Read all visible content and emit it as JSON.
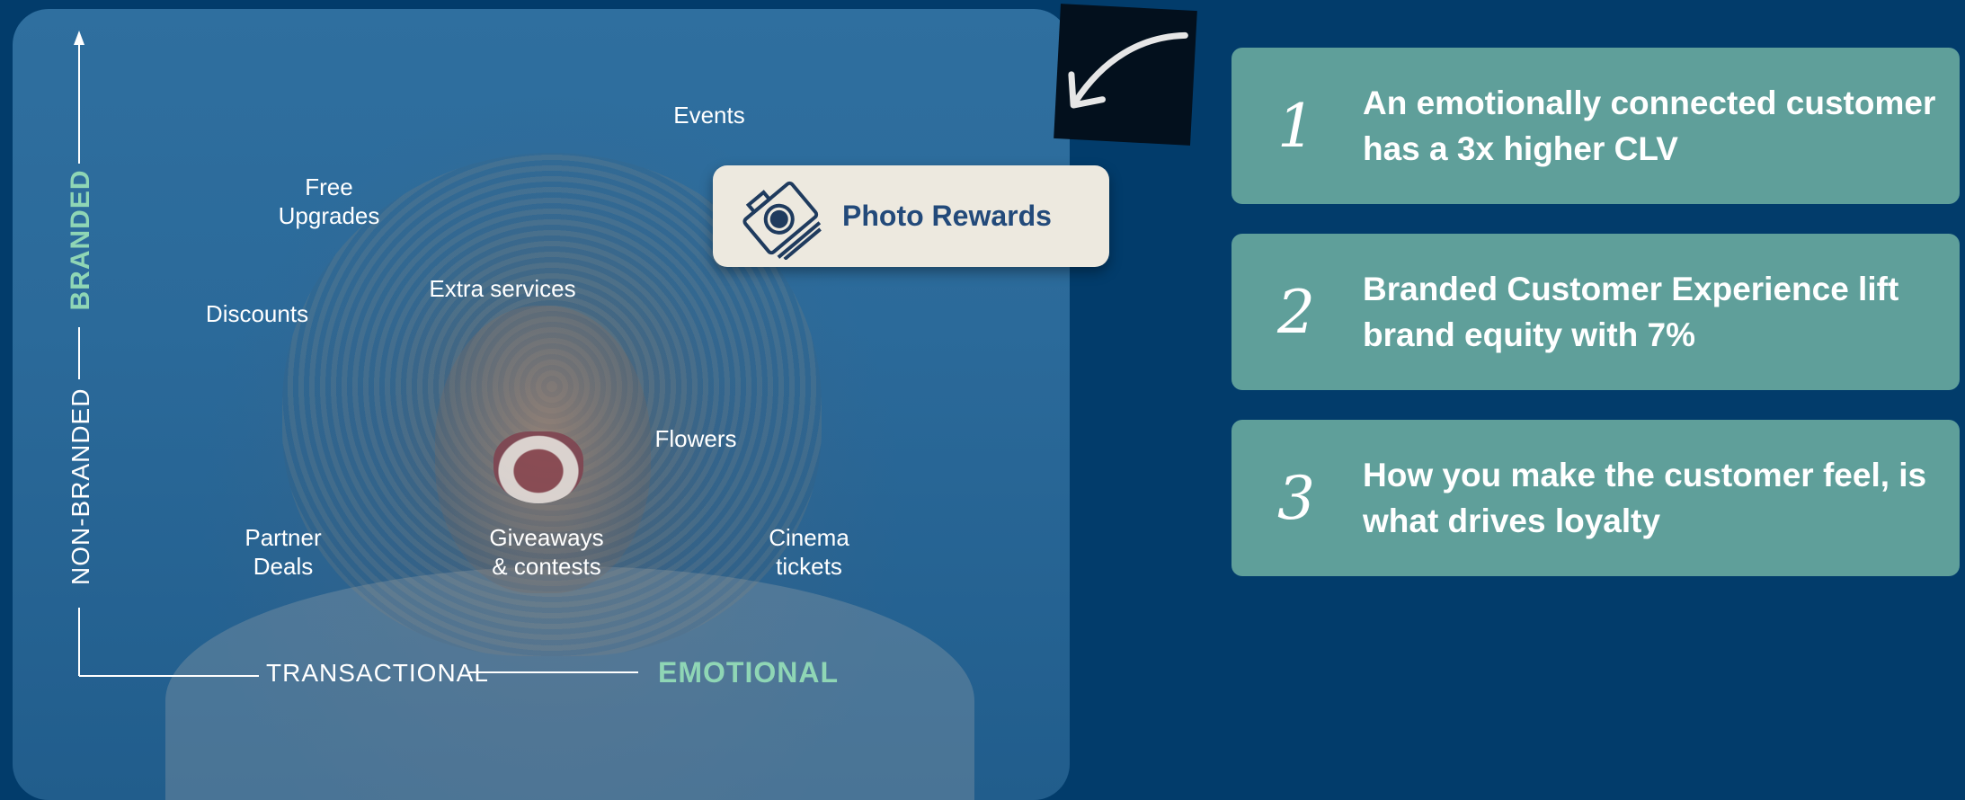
{
  "axes": {
    "y_top": "BRANDED",
    "y_bottom": "NON-BRANDED",
    "x_left": "TRANSACTIONAL",
    "x_right": "EMOTIONAL"
  },
  "items": [
    {
      "id": "events",
      "text": "Events"
    },
    {
      "id": "free-upgrades",
      "text": "Free\nUpgrades"
    },
    {
      "id": "extra-services",
      "text": "Extra services"
    },
    {
      "id": "discounts",
      "text": "Discounts"
    },
    {
      "id": "flowers",
      "text": "Flowers"
    },
    {
      "id": "partner-deals",
      "text": "Partner\nDeals"
    },
    {
      "id": "giveaways",
      "text": "Giveaways\n& contests"
    },
    {
      "id": "cinema-tickets",
      "text": "Cinema\ntickets"
    }
  ],
  "highlight": {
    "title": "Photo Rewards",
    "icon": "camera-icon"
  },
  "cards": [
    {
      "number": "1",
      "text": "An emotionally connected customer has a 3x higher CLV"
    },
    {
      "number": "2",
      "text": "Branded Customer Experience lift brand equity with 7%"
    },
    {
      "number": "3",
      "text": "How you make the customer feel, is what drives loyalty"
    }
  ],
  "colors": {
    "background": "#023c6b",
    "accent_green": "#8fd6b5",
    "card": "#5f9f9a",
    "reward_card": "#ede9df",
    "reward_text": "#234a7a"
  }
}
